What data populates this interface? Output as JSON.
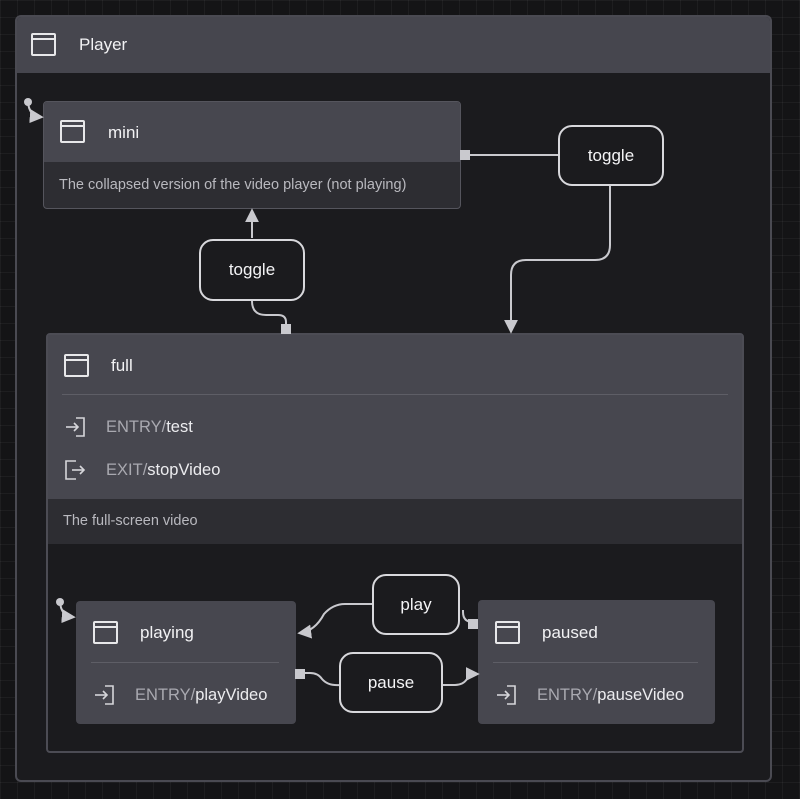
{
  "machine": {
    "title": "Player",
    "states": {
      "mini": {
        "title": "mini",
        "description": "The collapsed version of the video player (not playing)"
      },
      "full": {
        "title": "full",
        "entry": {
          "keyword": "ENTRY",
          "action": "test"
        },
        "exit": {
          "keyword": "EXIT",
          "action": "stopVideo"
        },
        "description": "The full-screen video"
      },
      "playing": {
        "title": "playing",
        "entry": {
          "keyword": "ENTRY",
          "action": "playVideo"
        }
      },
      "paused": {
        "title": "paused",
        "entry": {
          "keyword": "ENTRY",
          "action": "pauseVideo"
        }
      }
    },
    "events": {
      "mini_toggle": "toggle",
      "full_toggle": "toggle",
      "play": "play",
      "pause": "pause"
    },
    "separator": " / "
  }
}
